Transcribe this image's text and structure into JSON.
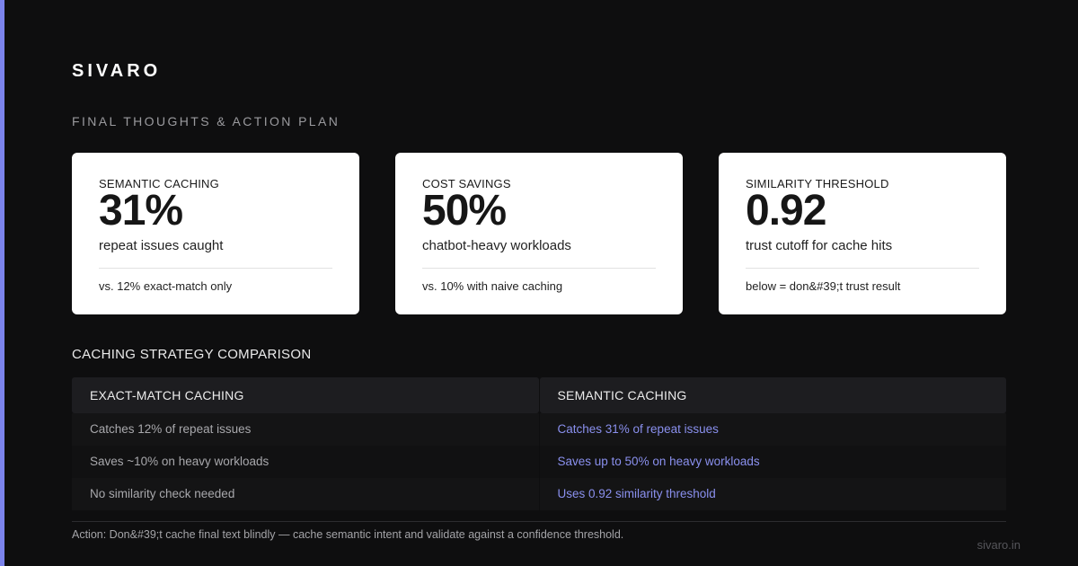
{
  "brand": "SIVARO",
  "subtitle": "FINAL THOUGHTS & ACTION PLAN",
  "cards": [
    {
      "label": "SEMANTIC CACHING",
      "value": "31%",
      "caption": "repeat issues caught",
      "note": "vs. 12% exact-match only"
    },
    {
      "label": "COST SAVINGS",
      "value": "50%",
      "caption": "chatbot-heavy workloads",
      "note": "vs. 10% with naive caching"
    },
    {
      "label": "SIMILARITY THRESHOLD",
      "value": "0.92",
      "caption": "trust cutoff for cache hits",
      "note": "below = don&#39;t trust result"
    }
  ],
  "comparison": {
    "title": "CACHING STRATEGY COMPARISON",
    "left": {
      "header": "EXACT-MATCH CACHING",
      "rows": [
        "Catches 12% of repeat issues",
        "Saves ~10% on heavy workloads",
        "No similarity check needed"
      ]
    },
    "right": {
      "header": "SEMANTIC CACHING",
      "rows": [
        "Catches 31% of repeat issues",
        "Saves up to 50% on heavy workloads",
        "Uses 0.92 similarity threshold"
      ]
    }
  },
  "action": "Action: Don&#39;t cache final text blindly — cache semantic intent and validate against a confidence threshold.",
  "domain": "sivaro.in",
  "colors": {
    "accent": "#7b83eb",
    "background": "#0e0e0f",
    "highlight_text": "#8a90ee"
  }
}
